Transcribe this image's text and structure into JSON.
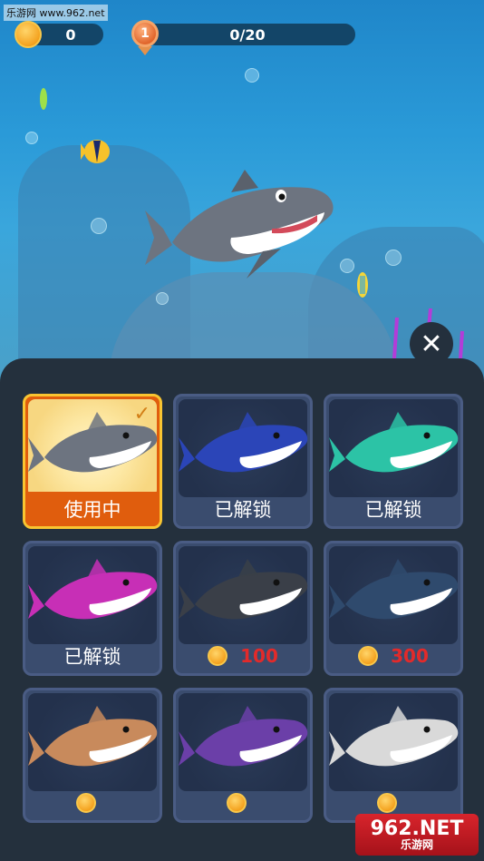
{
  "watermark": "乐游网 www.962.net",
  "hud": {
    "coins": "0",
    "medal_rank": "1",
    "progress": "0/20"
  },
  "close_icon": "close-icon",
  "cards": [
    {
      "label": "使用中",
      "type": "status",
      "selected": true,
      "color": "#6d7480"
    },
    {
      "label": "已解锁",
      "type": "status",
      "selected": false,
      "color": "#2b45b8"
    },
    {
      "label": "已解锁",
      "type": "status",
      "selected": false,
      "color": "#2cc3a6"
    },
    {
      "label": "已解锁",
      "type": "status",
      "selected": false,
      "color": "#c72fb6"
    },
    {
      "label": "100",
      "type": "price",
      "selected": false,
      "color": "#3a3f48"
    },
    {
      "label": "300",
      "type": "price",
      "selected": false,
      "color": "#2f4a6d"
    },
    {
      "label": "",
      "type": "price",
      "selected": false,
      "color": "#c88a5c"
    },
    {
      "label": "",
      "type": "price",
      "selected": false,
      "color": "#6b3fa8"
    },
    {
      "label": "",
      "type": "price",
      "selected": false,
      "color": "#d9d9d9"
    }
  ],
  "site_badge": {
    "line1": "962.NET",
    "line2": "乐游网"
  }
}
